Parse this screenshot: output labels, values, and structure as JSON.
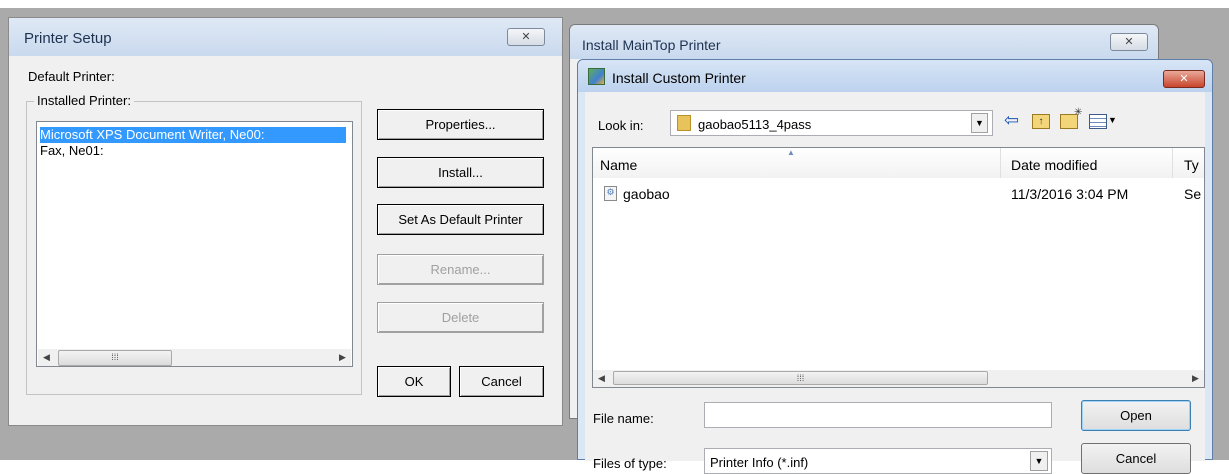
{
  "printer_setup": {
    "title": "Printer Setup",
    "close_glyph": "✕",
    "default_printer_label": "Default Printer:",
    "installed_printer_label": "Installed Printer:",
    "printers": [
      "Microsoft XPS Document Writer, Ne00:",
      "Fax, Ne01:"
    ],
    "scroll_grip": "⁞⁞⁞",
    "buttons": {
      "properties": "Properties...",
      "install": "Install...",
      "set_default": "Set As Default Printer",
      "rename": "Rename...",
      "delete": "Delete",
      "ok": "OK",
      "cancel": "Cancel"
    }
  },
  "maintop_window": {
    "title": "Install MainTop Printer",
    "close_glyph": "✕"
  },
  "custom_printer": {
    "title": "Install Custom Printer",
    "close_glyph": "✕",
    "look_in_label": "Look in:",
    "look_in_value": "gaobao5113_4pass",
    "columns": [
      "Name",
      "Date modified",
      "Ty"
    ],
    "files": [
      {
        "name": "gaobao",
        "date": "11/3/2016 3:04 PM",
        "type": "Se"
      }
    ],
    "scroll_grip": "⁞⁞⁞",
    "file_name_label": "File name:",
    "file_name_value": "",
    "files_of_type_label": "Files of type:",
    "files_of_type_value": "Printer Info (*.inf)",
    "open_label": "Open",
    "cancel_label": "Cancel"
  }
}
